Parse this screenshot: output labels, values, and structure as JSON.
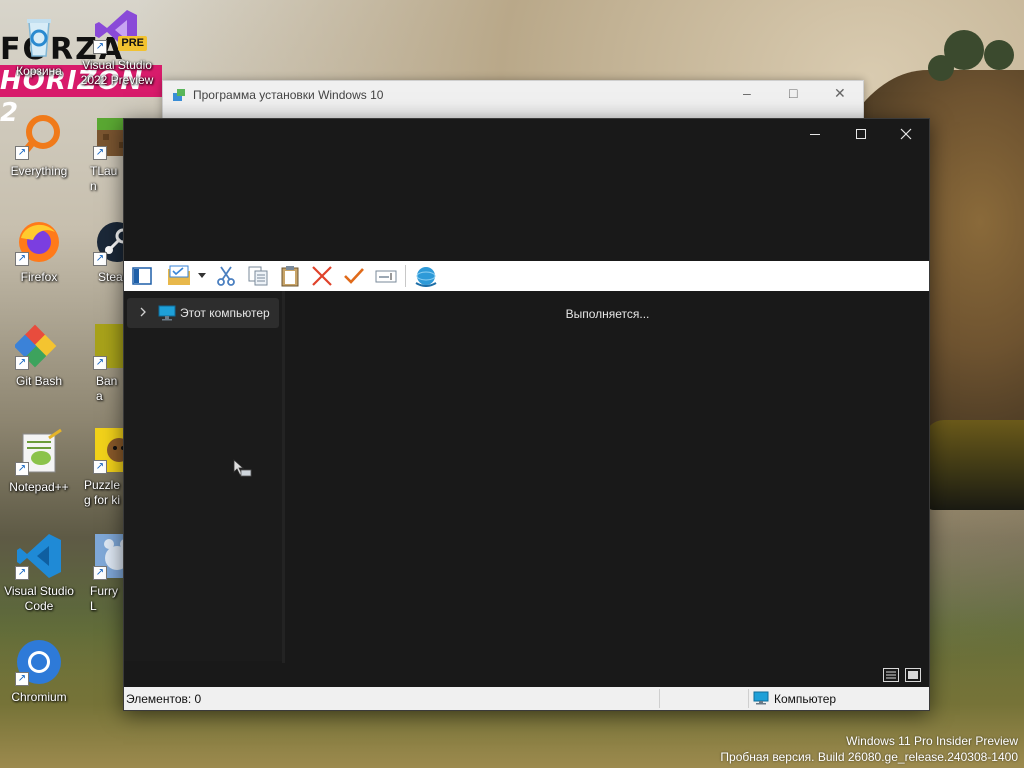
{
  "wallpaper": {
    "logo_top": "FORZA",
    "logo_bottom": "HORIZON 2"
  },
  "desktop_icons": [
    {
      "label": "Корзина",
      "icon": "recycle-bin-icon"
    },
    {
      "label": "Visual Studio 2022 Preview",
      "icon": "visual-studio-icon",
      "badge": "PRE"
    },
    {
      "label": "Everything",
      "icon": "everything-search-icon"
    },
    {
      "label": "TLaun",
      "icon": "minecraft-block-icon"
    },
    {
      "label": "Firefox",
      "icon": "firefox-icon"
    },
    {
      "label": "Stea",
      "icon": "steam-icon"
    },
    {
      "label": "Git Bash",
      "icon": "git-bash-icon"
    },
    {
      "label": "Bana",
      "icon": "banana-icon"
    },
    {
      "label": "Notepad++",
      "icon": "notepad-plus-plus-icon"
    },
    {
      "label": "Puzzle g for ki",
      "icon": "puzzle-game-icon"
    },
    {
      "label": "Visual Studio Code",
      "icon": "vscode-icon"
    },
    {
      "label": "Furry L",
      "icon": "furry-game-icon"
    },
    {
      "label": "Chromium",
      "icon": "chromium-icon"
    }
  ],
  "setup_window": {
    "title": "Программа установки Windows 10",
    "minimize": "–",
    "maximize": "□",
    "close": "✕"
  },
  "explorer_window": {
    "titlebar_buttons": {
      "minimize": "minimize-icon",
      "maximize": "maximize-icon",
      "close": "close-icon"
    },
    "toolbar": [
      {
        "name": "navigation-pane-button",
        "icon": "navigation-pane-icon"
      },
      {
        "name": "new-folder-button",
        "icon": "folder-check-icon"
      },
      {
        "name": "new-folder-dropdown",
        "icon": "dropdown-arrow-icon"
      },
      {
        "name": "cut-button",
        "icon": "scissors-icon"
      },
      {
        "name": "copy-button",
        "icon": "copy-icon"
      },
      {
        "name": "paste-button",
        "icon": "clipboard-icon"
      },
      {
        "name": "delete-button",
        "icon": "delete-x-icon"
      },
      {
        "name": "accept-button",
        "icon": "checkmark-icon"
      },
      {
        "name": "rename-button",
        "icon": "rename-icon"
      },
      {
        "name": "shell-button",
        "icon": "globe-icon"
      }
    ],
    "tree": {
      "items": [
        {
          "label": "Этот компьютер",
          "icon": "this-pc-icon",
          "expanded": false
        }
      ]
    },
    "content": {
      "status_message": "Выполняется..."
    },
    "view_buttons": [
      "details-view-icon",
      "large-icons-view-icon"
    ],
    "statusbar": {
      "items_count": "Элементов: 0",
      "location": "Компьютер"
    }
  },
  "watermark": {
    "line1": "Windows 11 Pro Insider Preview",
    "line2": "Пробная версия. Build 26080.ge_release.240308-1400"
  },
  "colors": {
    "window_bg": "#191919",
    "tree_selected": "#2d2d2d",
    "toolbar_bg": "#ffffff",
    "statusbar_bg": "#f0f0f0",
    "delete_icon": "#e0422a",
    "accept_icon": "#e06a1a",
    "folder_icon": "#e8b84b",
    "pc_icon": "#1ea0d8"
  }
}
